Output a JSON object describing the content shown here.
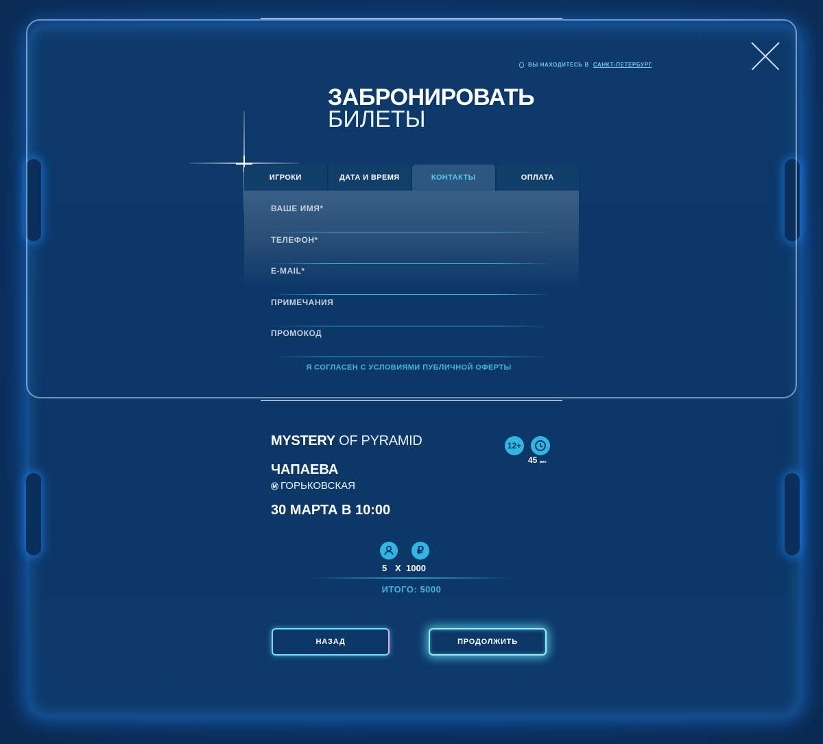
{
  "location": {
    "prefix": "ВЫ НАХОДИТЕСЬ В",
    "city": "САНКТ-ПЕТЕРБУРГ"
  },
  "title": {
    "line1": "ЗАБРОНИРОВАТЬ",
    "line2": "БИЛЕТЫ"
  },
  "tabs": [
    {
      "label": "ИГРОКИ",
      "active": false
    },
    {
      "label": "ДАТА И ВРЕМЯ",
      "active": false
    },
    {
      "label": "КОНТАКТЫ",
      "active": true
    },
    {
      "label": "ОПЛАТА",
      "active": false
    }
  ],
  "form": {
    "fields": [
      {
        "label": "ВАШЕ ИМЯ*",
        "value": ""
      },
      {
        "label": "ТЕЛЕФОН*",
        "value": ""
      },
      {
        "label": "E-MAIL*",
        "value": ""
      },
      {
        "label": "ПРИМЕЧАНИЯ",
        "value": ""
      },
      {
        "label": "ПРОМОКОД",
        "value": ""
      }
    ],
    "agree": "Я СОГЛАСЕН С УСЛОВИЯМИ ПУБЛИЧНОЙ ОФЕРТЫ"
  },
  "summary": {
    "game_bold": "MYSTERY",
    "game_rest": "OF PYRAMID",
    "age": "12+",
    "duration": "45",
    "duration_unit": "мин",
    "street": "ЧАПАЕВА",
    "metro_icon": "metro-icon",
    "metro": "ГОРЬКОВСКАЯ",
    "date": "30 МАРТА В 10:00",
    "players": "5",
    "times": "X",
    "price": "1000",
    "total": "ИТОГО: 5000"
  },
  "buttons": {
    "back": "НАЗАД",
    "next": "ПРОДОЛЖИТЬ"
  },
  "colors": {
    "accent": "#2fb7e3",
    "background": "#0b3262"
  }
}
